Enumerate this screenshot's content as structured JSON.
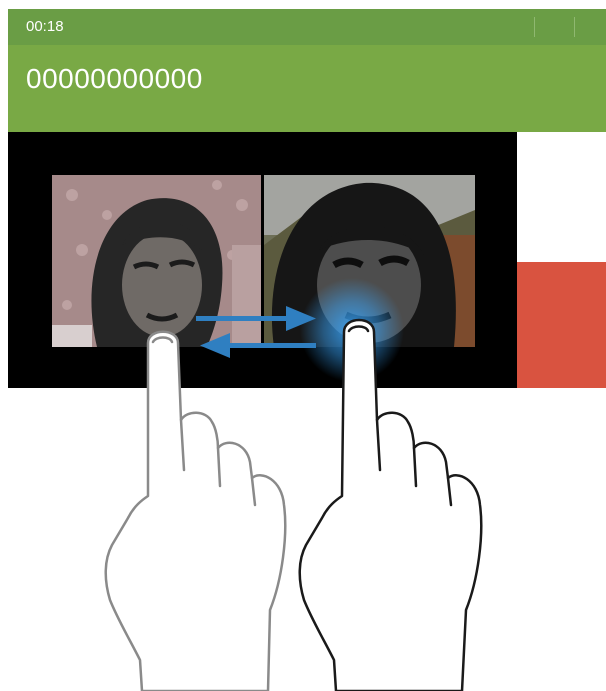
{
  "status_bar": {
    "time": "00:18"
  },
  "call": {
    "number": "00000000000"
  },
  "colors": {
    "status_bar_bg": "#6a9d45",
    "header_bg": "#79a945",
    "end_call": "#d95340",
    "swap_arrow": "#2f7fc1",
    "touch_glow": "#3aa8ff"
  },
  "icons": {
    "swap": "swap-arrows-icon",
    "hand_left": "finger-icon",
    "hand_right": "finger-icon"
  }
}
